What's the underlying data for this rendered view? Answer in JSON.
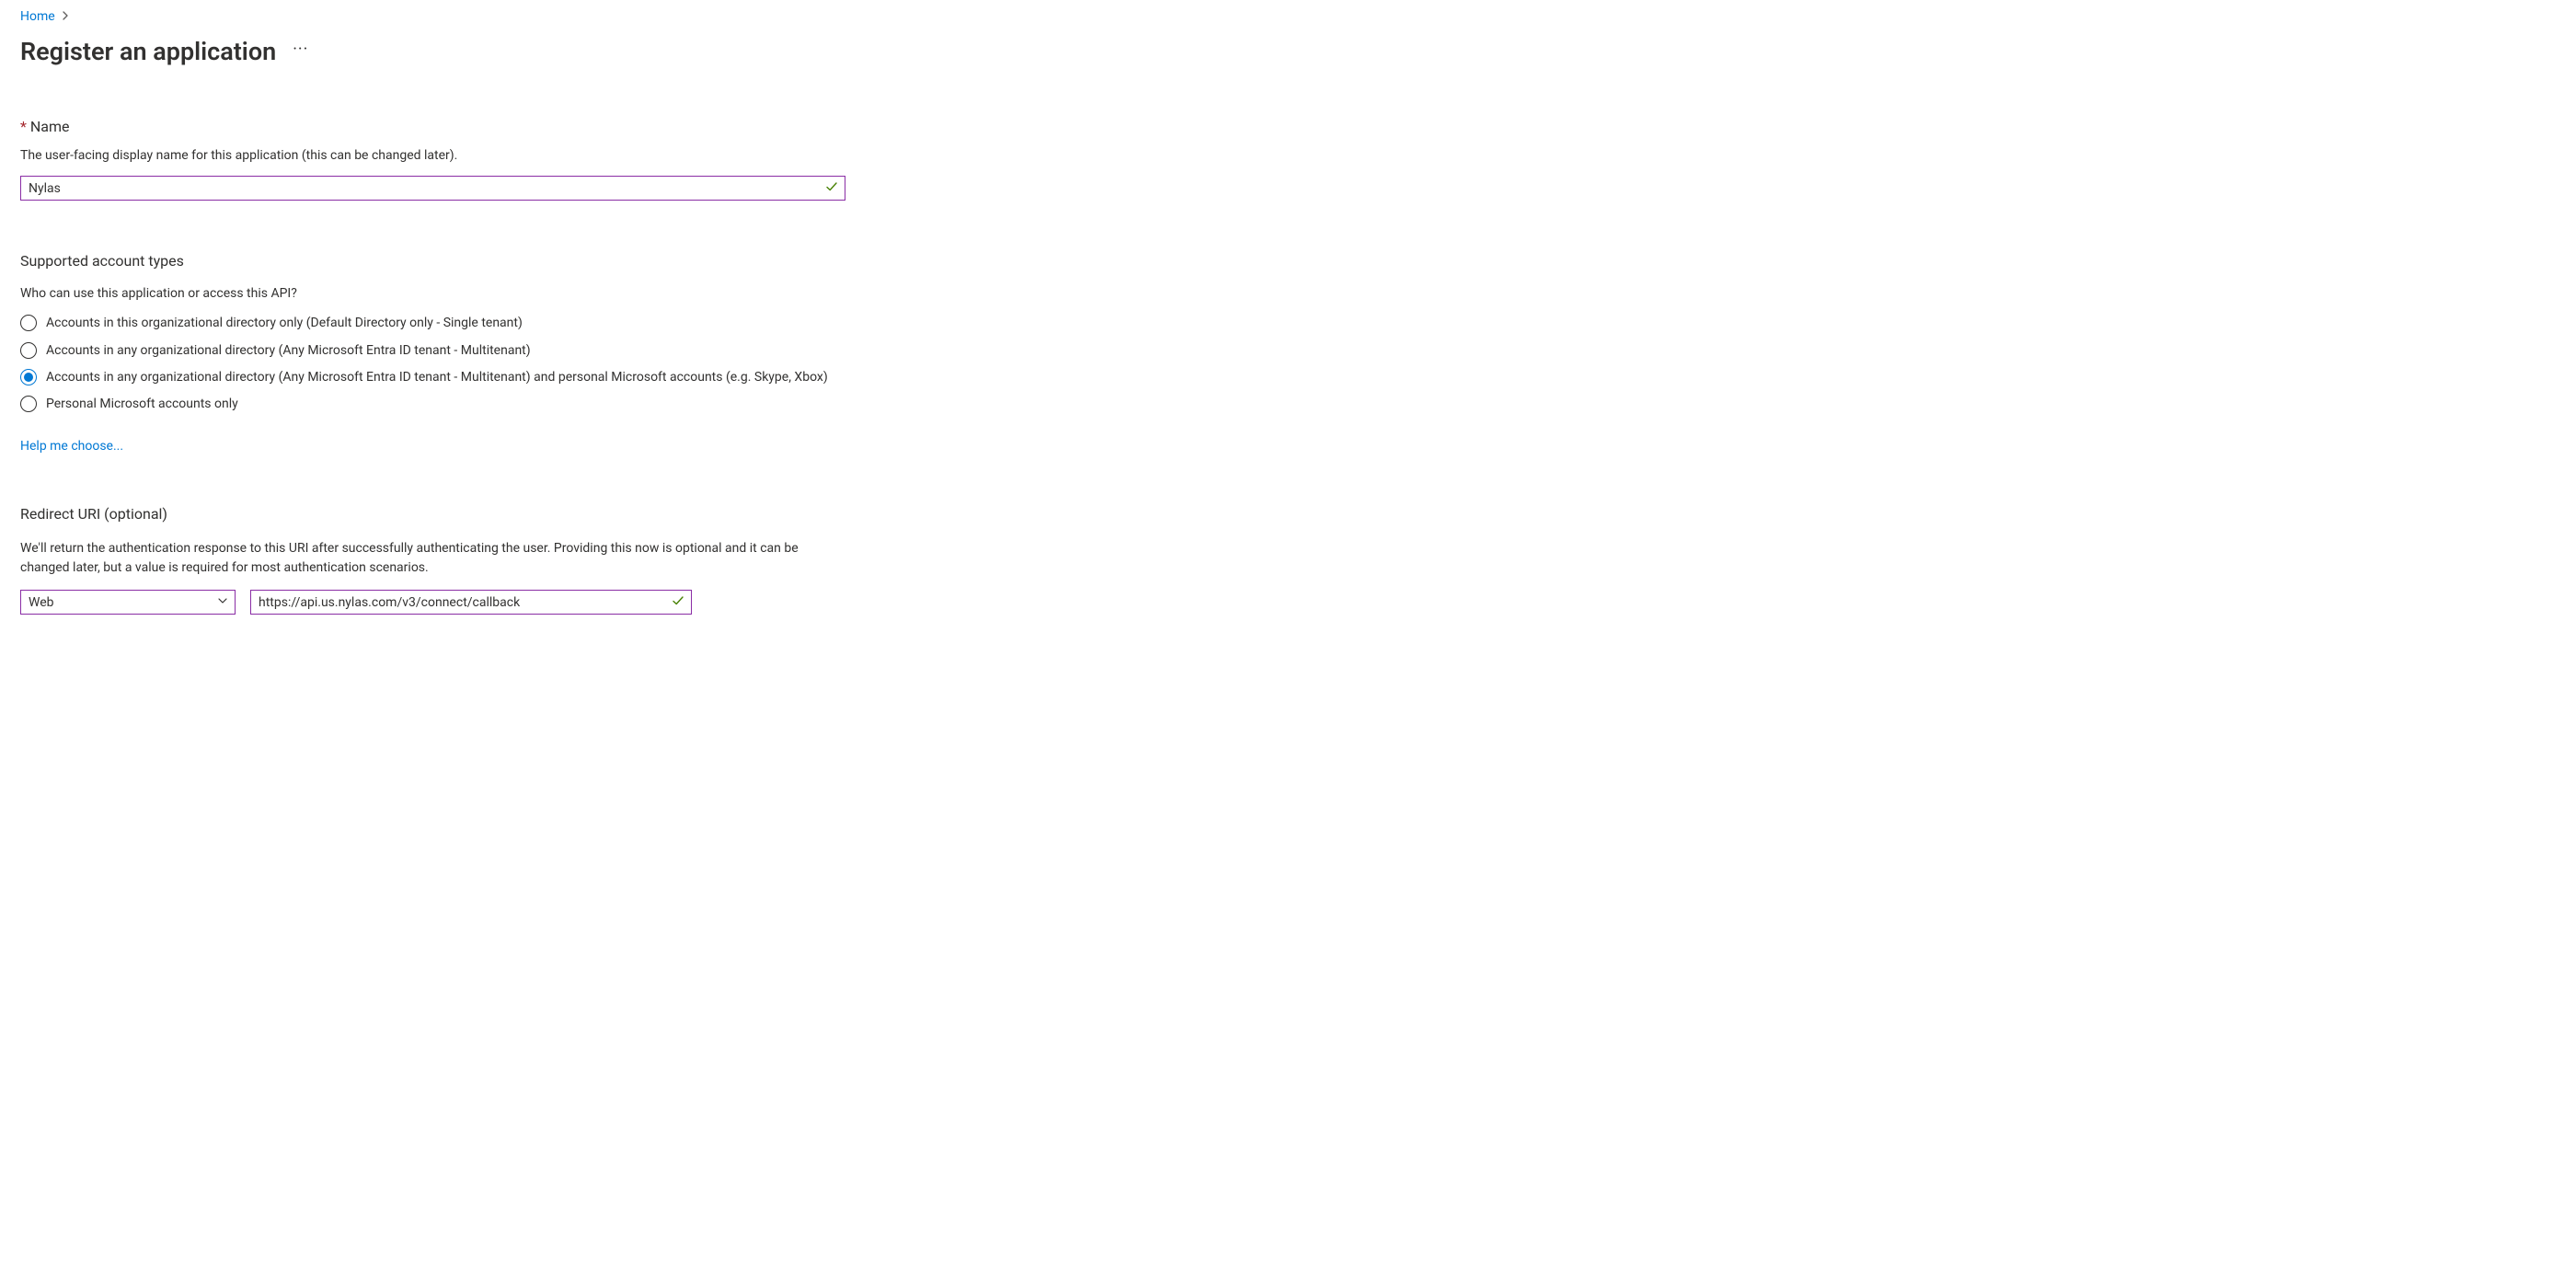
{
  "breadcrumb": {
    "home": "Home"
  },
  "page_title": "Register an application",
  "name_section": {
    "label": "Name",
    "description": "The user-facing display name for this application (this can be changed later).",
    "value": "Nylas"
  },
  "account_types": {
    "heading": "Supported account types",
    "description": "Who can use this application or access this API?",
    "options": [
      "Accounts in this organizational directory only (Default Directory only - Single tenant)",
      "Accounts in any organizational directory (Any Microsoft Entra ID tenant - Multitenant)",
      "Accounts in any organizational directory (Any Microsoft Entra ID tenant - Multitenant) and personal Microsoft accounts (e.g. Skype, Xbox)",
      "Personal Microsoft accounts only"
    ],
    "selected_index": 2,
    "help_link": "Help me choose..."
  },
  "redirect": {
    "heading": "Redirect URI (optional)",
    "description": "We'll return the authentication response to this URI after successfully authenticating the user. Providing this now is optional and it can be changed later, but a value is required for most authentication scenarios.",
    "platform": "Web",
    "uri": "https://api.us.nylas.com/v3/connect/callback"
  }
}
